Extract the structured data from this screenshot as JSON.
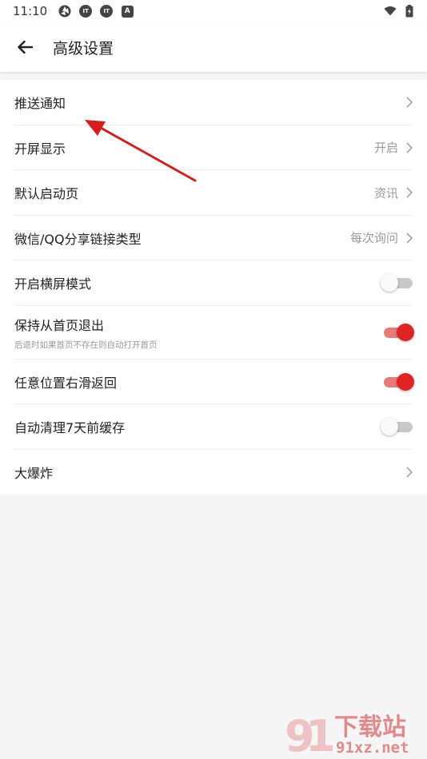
{
  "status_bar": {
    "time": "11:10",
    "icons": [
      "aperture-icon",
      "app-icon",
      "app-icon",
      "a-icon",
      "wifi-icon",
      "battery-icon"
    ],
    "a_glyph": "A"
  },
  "header": {
    "title": "高级设置"
  },
  "settings": [
    {
      "label": "推送通知",
      "value": "",
      "type": "link"
    },
    {
      "label": "开屏显示",
      "value": "开启",
      "type": "link"
    },
    {
      "label": "默认启动页",
      "value": "资讯",
      "type": "link"
    },
    {
      "label": "微信/QQ分享链接类型",
      "value": "每次询问",
      "type": "link"
    },
    {
      "label": "开启横屏模式",
      "type": "toggle",
      "on": false
    },
    {
      "label": "保持从首页退出",
      "sub": "后退时如果首页不存在则自动打开首页",
      "type": "toggle",
      "on": true
    },
    {
      "label": "任意位置右滑返回",
      "type": "toggle",
      "on": true
    },
    {
      "label": "自动清理7天前缓存",
      "type": "toggle",
      "on": false
    },
    {
      "label": "大爆炸",
      "value": "",
      "type": "link"
    }
  ],
  "watermark": {
    "main": "下载站",
    "domain": "91xz.net"
  },
  "colors": {
    "accent": "#e02424",
    "accent_track": "#e87a7a",
    "arrow": "#d91c1c"
  }
}
